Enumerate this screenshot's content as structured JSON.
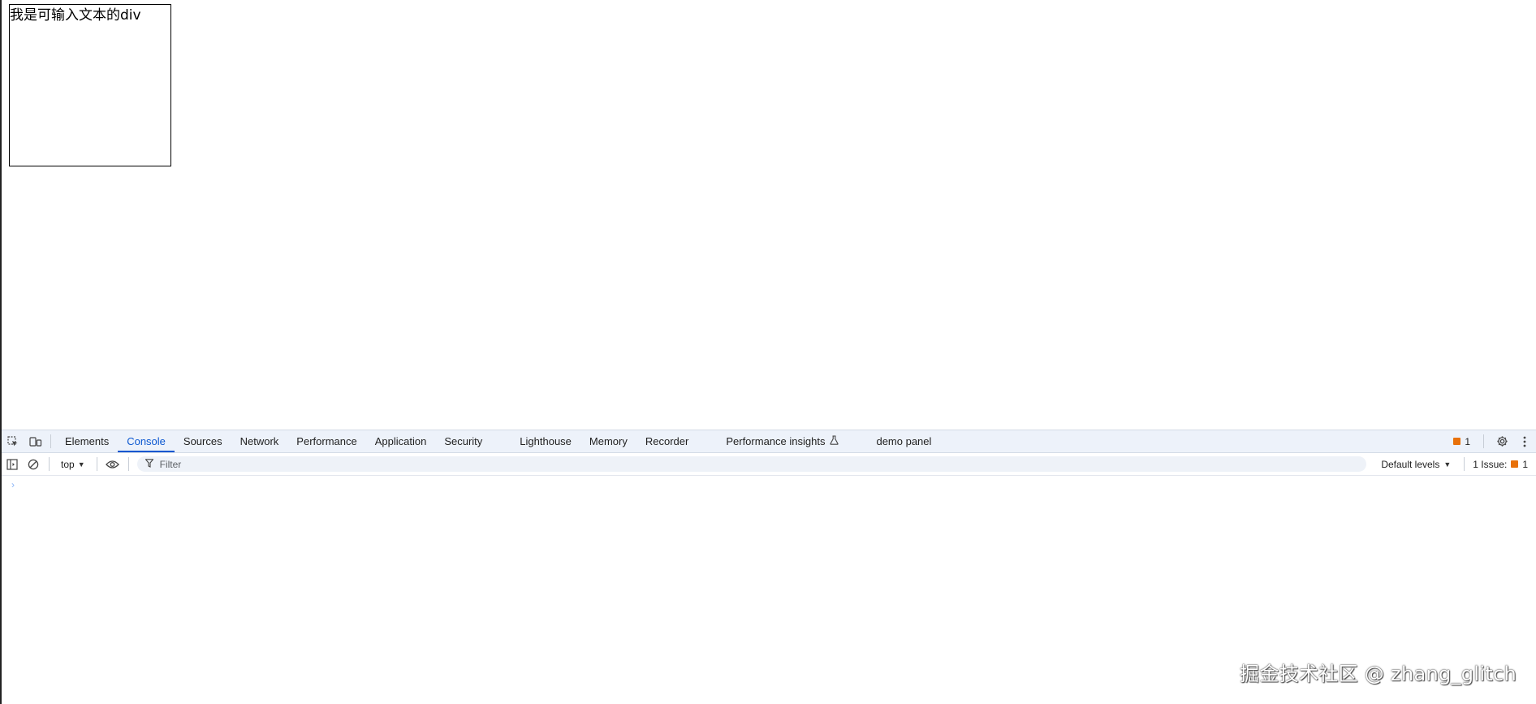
{
  "page": {
    "editable_text": "我是可输入文本的div"
  },
  "devtools": {
    "tabs": [
      {
        "label": "Elements"
      },
      {
        "label": "Console"
      },
      {
        "label": "Sources"
      },
      {
        "label": "Network"
      },
      {
        "label": "Performance"
      },
      {
        "label": "Application"
      },
      {
        "label": "Security"
      },
      {
        "label": "Lighthouse"
      },
      {
        "label": "Memory"
      },
      {
        "label": "Recorder"
      },
      {
        "label": "Performance insights"
      },
      {
        "label": "demo panel"
      }
    ],
    "active_tab": "Console",
    "issues_badge_count": "1",
    "toolbar": {
      "context": "top",
      "filter_placeholder": "Filter",
      "levels": "Default levels",
      "issue_label": "1 Issue:",
      "issue_count": "1"
    },
    "console_prompt": "›"
  },
  "watermark": "掘金技术社区 @ zhang_glitch",
  "colors": {
    "accent": "#0b57d0",
    "tabbar_bg": "#edf2fa",
    "issue_flag": "#e8710a"
  },
  "icons": [
    "inspect-element-icon",
    "device-toggle-icon",
    "sidebar-toggle-icon",
    "clear-console-icon",
    "eye-icon",
    "filter-icon",
    "flask-icon",
    "gear-icon",
    "more-vertical-icon",
    "issue-flag-icon"
  ]
}
